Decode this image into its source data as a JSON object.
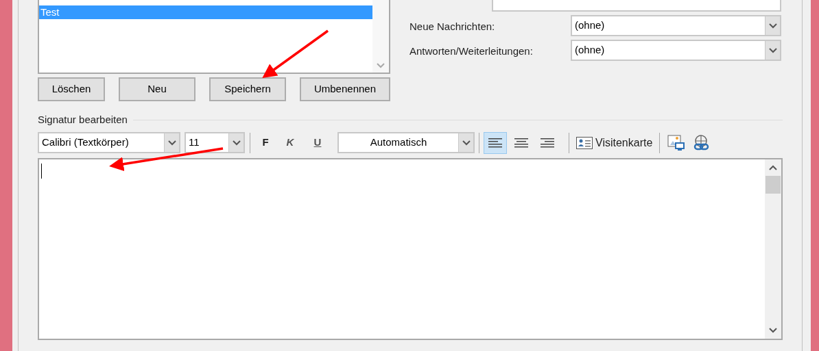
{
  "signature_list": {
    "items": [
      {
        "label": "Test",
        "selected": true
      }
    ]
  },
  "list_buttons": [
    {
      "label": "Löschen"
    },
    {
      "label": "Neu"
    },
    {
      "label": "Speichern"
    },
    {
      "label": "Umbenennen"
    }
  ],
  "default_signature": {
    "fields": [
      {
        "label": "Neue Nachrichten:",
        "value": "(ohne)"
      },
      {
        "label": "Antworten/Weiterleitungen:",
        "value": "(ohne)"
      }
    ]
  },
  "editor_section": {
    "title": "Signatur bearbeiten",
    "toolbar": {
      "font": "Calibri (Textkörper)",
      "size": "11",
      "bold": "F",
      "italic": "K",
      "underline": "U",
      "font_color_choice": "Automatisch",
      "alignment": [
        {
          "kind": "left",
          "selected": true
        },
        {
          "kind": "center",
          "selected": false
        },
        {
          "kind": "right",
          "selected": false
        }
      ],
      "business_card": {
        "label": "Visitenkarte"
      }
    }
  }
}
